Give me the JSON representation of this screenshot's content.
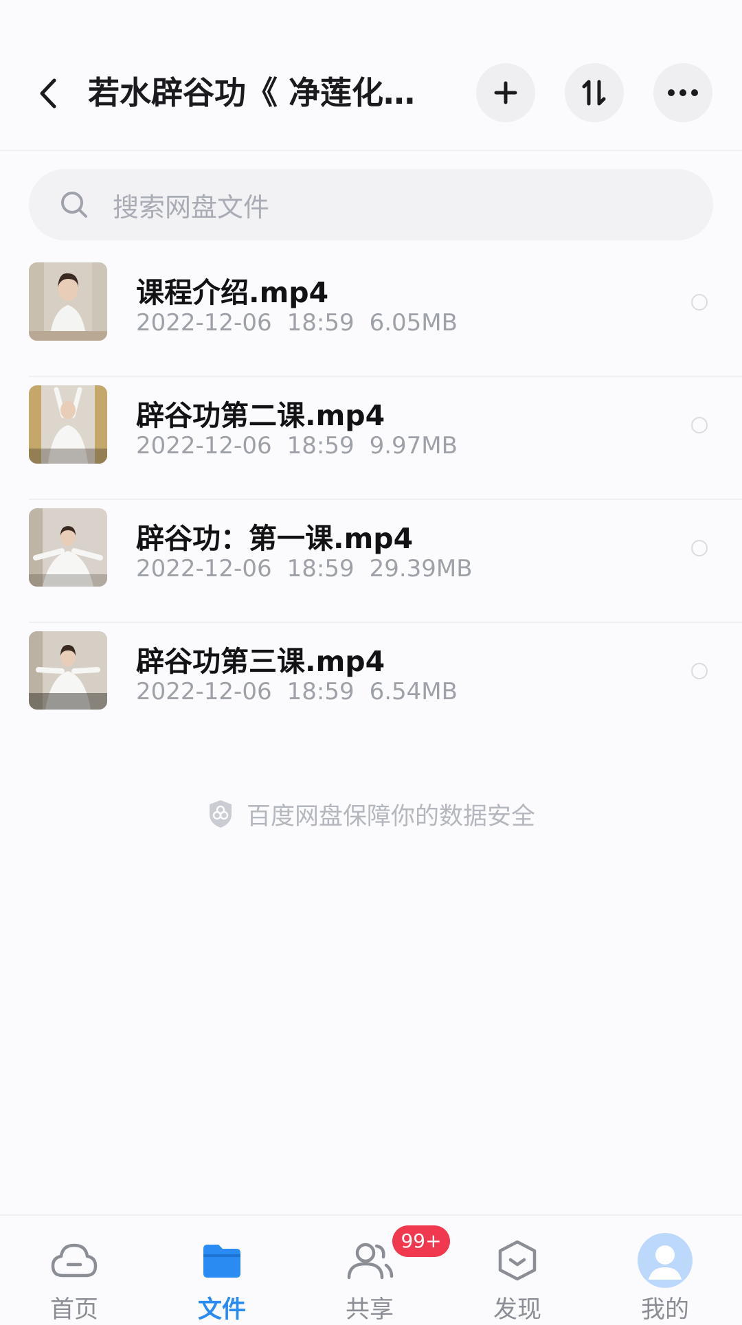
{
  "header": {
    "title": "若水辟谷功《 净莲化..."
  },
  "search": {
    "placeholder": "搜索网盘文件"
  },
  "files": [
    {
      "name": "课程介绍.mp4",
      "date": "2022-12-06",
      "time": "18:59",
      "size": "6.05MB"
    },
    {
      "name": "辟谷功第二课.mp4",
      "date": "2022-12-06",
      "time": "18:59",
      "size": "9.97MB"
    },
    {
      "name": "辟谷功：第一课.mp4",
      "date": "2022-12-06",
      "time": "18:59",
      "size": "29.39MB"
    },
    {
      "name": "辟谷功第三课.mp4",
      "date": "2022-12-06",
      "time": "18:59",
      "size": "6.54MB"
    }
  ],
  "safety_note": "百度网盘保障你的数据安全",
  "tabs": [
    {
      "label": "首页"
    },
    {
      "label": "文件"
    },
    {
      "label": "共享",
      "badge": "99+"
    },
    {
      "label": "发现"
    },
    {
      "label": "我的"
    }
  ],
  "colors": {
    "accent": "#2a8cf2",
    "badge": "#f0384e"
  }
}
